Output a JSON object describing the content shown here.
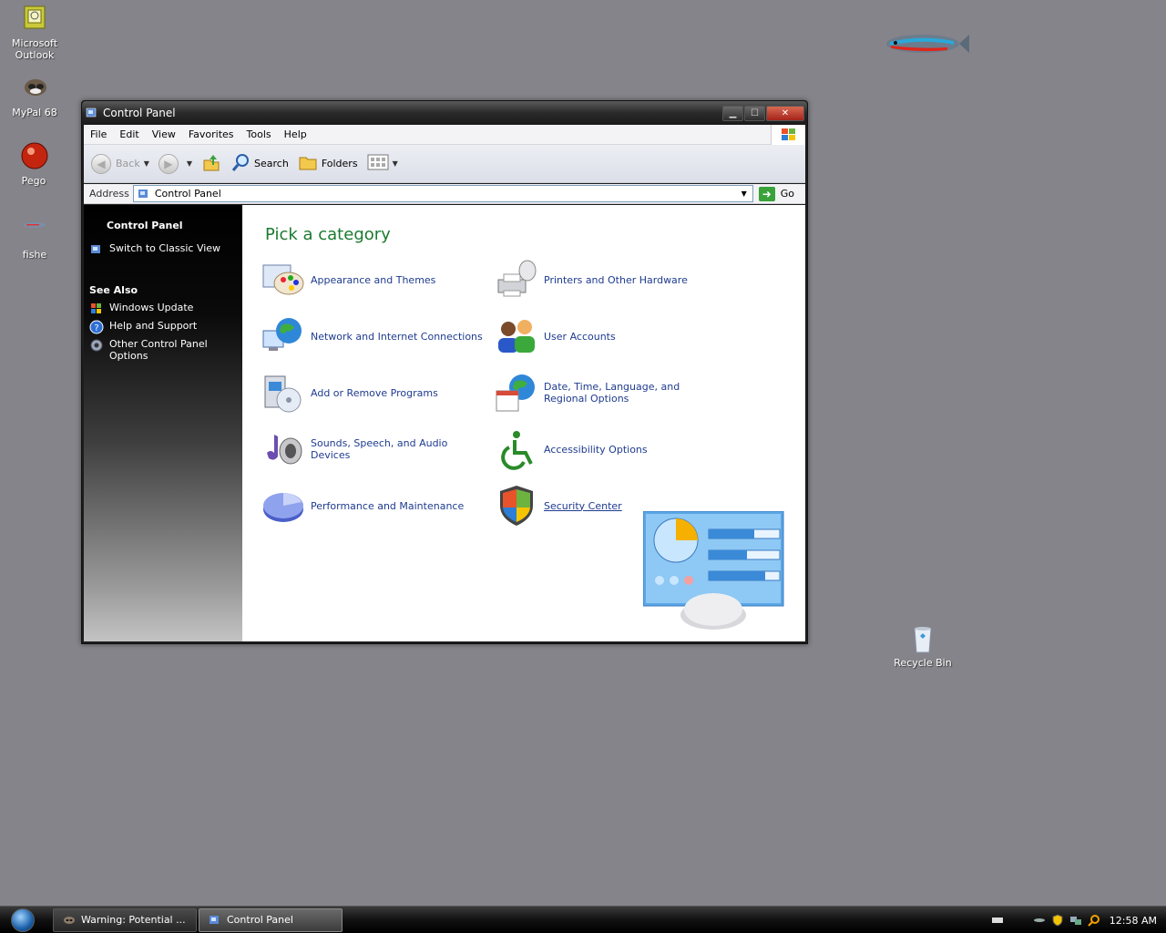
{
  "desktop": {
    "icons": [
      {
        "label": "Microsoft Outlook"
      },
      {
        "label": "MyPal 68"
      },
      {
        "label": "Pego"
      },
      {
        "label": "fishe"
      }
    ],
    "recycle_bin": "Recycle Bin"
  },
  "window": {
    "title": "Control Panel",
    "menu": [
      "File",
      "Edit",
      "View",
      "Favorites",
      "Tools",
      "Help"
    ],
    "toolbar": {
      "back": "Back",
      "search": "Search",
      "folders": "Folders"
    },
    "address": {
      "label": "Address",
      "value": "Control Panel",
      "go": "Go"
    },
    "sidepane": {
      "header": "Control Panel",
      "switch_link": "Switch to Classic View",
      "see_also": "See Also",
      "see_also_items": [
        "Windows Update",
        "Help and Support",
        "Other Control Panel Options"
      ]
    },
    "content": {
      "heading": "Pick a category",
      "categories": [
        "Appearance and Themes",
        "Printers and Other Hardware",
        "Network and Internet Connections",
        "User Accounts",
        "Add or Remove Programs",
        "Date, Time, Language, and Regional Options",
        "Sounds, Speech, and Audio Devices",
        "Accessibility Options",
        "Performance and Maintenance",
        "Security Center"
      ]
    }
  },
  "taskbar": {
    "tasks": [
      "Warning: Potential ...",
      "Control Panel"
    ],
    "clock": "12:58 AM"
  },
  "colors": {
    "desktop": "#85848a",
    "heading_green": "#1b7a30",
    "link_blue": "#1e3b8f"
  }
}
